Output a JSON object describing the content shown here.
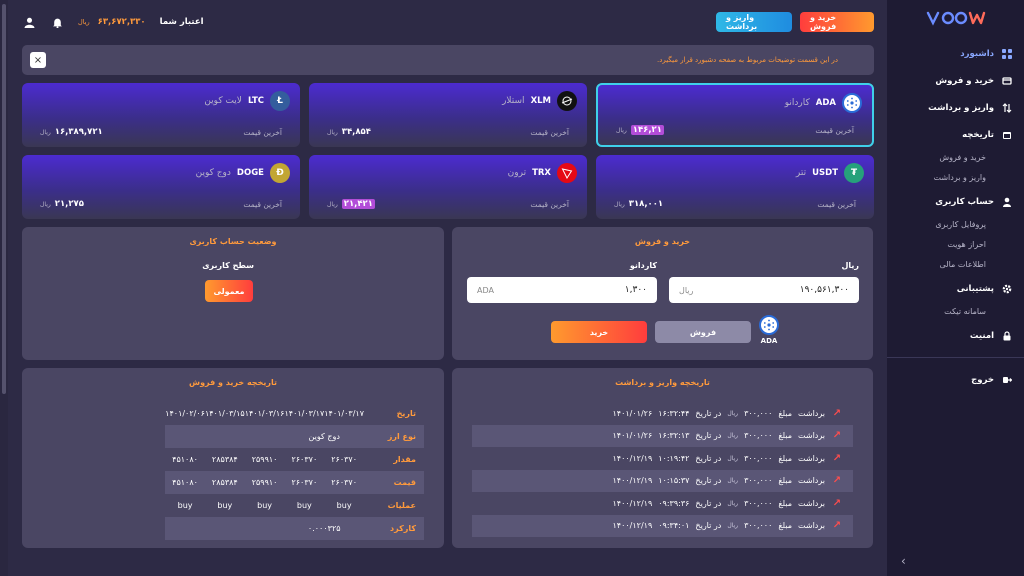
{
  "topbar": {
    "credit_label": "اعتبار شما",
    "credit_amount": "۶۳,۶۷۲,۳۳۰",
    "credit_unit": "ریال",
    "buy_sell_button": "خرید و فروش",
    "deposit_withdraw_button": "واریز و برداشت"
  },
  "notice": {
    "text": "در این قسمت توضیحات مربوط به صفحه دشبورد قرار میگیرد.",
    "close": "×"
  },
  "cards": [
    {
      "symbol": "ADA",
      "name": "کاردانو",
      "price_label": "آخرین قیمت",
      "price": "۱۴۶,۲۱",
      "unit": "ریال",
      "highlight": true
    },
    {
      "symbol": "XLM",
      "name": "استلار",
      "price_label": "آخرین قیمت",
      "price": "۳۴,۸۵۴",
      "unit": "ریال"
    },
    {
      "symbol": "LTC",
      "name": "لایت کوین",
      "price_label": "آخرین قیمت",
      "price": "۱۶,۳۸۹,۷۲۱",
      "unit": "ریال"
    },
    {
      "symbol": "USDT",
      "name": "تتر",
      "price_label": "آخرین قیمت",
      "price": "۳۱۸,۰۰۱",
      "unit": "ریال"
    },
    {
      "symbol": "TRX",
      "name": "ترون",
      "price_label": "آخرین قیمت",
      "price": "۲۱,۴۲۱",
      "unit": "ریال",
      "highlight": true
    },
    {
      "symbol": "DOGE",
      "name": "دوج کوین",
      "price_label": "آخرین قیمت",
      "price": "۲۱,۲۷۵",
      "unit": "ریال"
    }
  ],
  "trade": {
    "title": "خرید و فروش",
    "rial_label": "ریال",
    "rial_value": "۱۹۰,۵۶۱,۳۰۰",
    "rial_unit": "ریال",
    "coin_label": "کاردانو",
    "coin_value": "۱,۳۰۰",
    "coin_unit": "ADA",
    "selected_coin": "ADA",
    "sell_button": "فروش",
    "buy_button": "خرید"
  },
  "account_status": {
    "title": "وضعیت حساب کاربری",
    "level_label": "سطح کاربری",
    "level_value": "معمولی"
  },
  "transactions": {
    "title": "تاریخچه واریز و برداشت",
    "rows": [
      {
        "type": "برداشت",
        "amount_label": "مبلغ",
        "amount": "۳۰۰,۰۰۰",
        "unit": "ریال",
        "date_label": "در تاریخ",
        "time": "۱۶:۳۲:۴۴",
        "date": "۱۴۰۱/۰۱/۲۶"
      },
      {
        "type": "برداشت",
        "amount_label": "مبلغ",
        "amount": "۳۰۰,۰۰۰",
        "unit": "ریال",
        "date_label": "در تاریخ",
        "time": "۱۶:۳۲:۱۳",
        "date": "۱۴۰۱/۰۱/۲۶"
      },
      {
        "type": "برداشت",
        "amount_label": "مبلغ",
        "amount": "۳۰۰,۰۰۰",
        "unit": "ریال",
        "date_label": "در تاریخ",
        "time": "۱۰:۱۹:۴۲",
        "date": "۱۴۰۰/۱۲/۱۹"
      },
      {
        "type": "برداشت",
        "amount_label": "مبلغ",
        "amount": "۳۰۰,۰۰۰",
        "unit": "ریال",
        "date_label": "در تاریخ",
        "time": "۱۰:۱۵:۳۷",
        "date": "۱۴۰۰/۱۲/۱۹"
      },
      {
        "type": "برداشت",
        "amount_label": "مبلغ",
        "amount": "۳۰۰,۰۰۰",
        "unit": "ریال",
        "date_label": "در تاریخ",
        "time": "۰۹:۳۹:۳۶",
        "date": "۱۴۰۰/۱۲/۱۹"
      },
      {
        "type": "برداشت",
        "amount_label": "مبلغ",
        "amount": "۳۰۰,۰۰۰",
        "unit": "ریال",
        "date_label": "در تاریخ",
        "time": "۰۹:۳۴:۰۱",
        "date": "۱۴۰۰/۱۲/۱۹"
      }
    ]
  },
  "trade_history": {
    "title": "تاریخچه خرید و فروش",
    "row_labels": [
      "تاریخ",
      "نوع ارز",
      "مقدار",
      "قیمت",
      "عملیات",
      "کارکرد"
    ],
    "dates": [
      "۱۴۰۱/۰۳/۱۷",
      "۱۴۰۱/۰۳/۱۷",
      "۱۴۰۱/۰۳/۱۶",
      "۱۴۰۱/۰۳/۱۵",
      "۱۴۰۱/۰۲/۰۶"
    ],
    "currency": "دوج کوین",
    "amounts": [
      "۲۶۰۳۷۰",
      "۲۶۰۳۷۰",
      "۲۵۹۹۱۰",
      "۲۸۵۳۸۴",
      "۴۵۱۰۸۰"
    ],
    "prices": [
      "۲۶۰۳۷۰",
      "۲۶۰۳۷۰",
      "۲۵۹۹۱۰",
      "۲۸۵۳۸۴",
      "۴۵۱۰۸۰"
    ],
    "operations": [
      "buy",
      "buy",
      "buy",
      "buy",
      "buy"
    ],
    "performance": "۰.۰۰۰۳۲۵"
  },
  "sidebar": {
    "logo": "VOOW",
    "items": [
      {
        "label": "داشبورد",
        "icon": "grid-icon",
        "active": true
      },
      {
        "label": "خرید و فروش",
        "icon": "swap-icon"
      },
      {
        "label": "واریز و برداشت",
        "icon": "arrows-icon"
      },
      {
        "label": "تاریخچه",
        "icon": "calendar-icon"
      }
    ],
    "history_sub": [
      "خرید و فروش",
      "واریز و برداشت"
    ],
    "account": {
      "label": "حساب کاربری",
      "icon": "user-icon"
    },
    "account_sub": [
      "پروفایل کاربری",
      "احراز هویت",
      "اطلاعات مالی"
    ],
    "support": {
      "label": "پشتیبانی",
      "icon": "gear-icon"
    },
    "support_sub": [
      "سامانه تیکت"
    ],
    "security": {
      "label": "امنیت",
      "icon": "lock-icon"
    },
    "logout": {
      "label": "خروج",
      "icon": "logout-icon"
    }
  },
  "colors": {
    "accent": "#ff9a3c",
    "background": "#2d2a45",
    "panel": "#4a4663",
    "sidebar": "#1e1b33"
  }
}
